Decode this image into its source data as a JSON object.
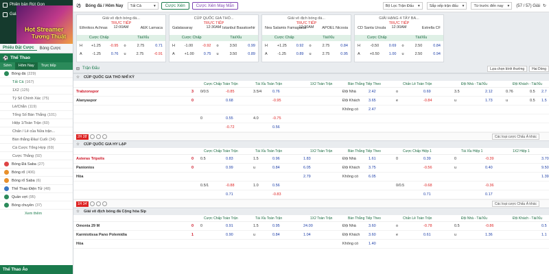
{
  "sidebar": {
    "top_buttons": [
      "Phiên bản Rút Gọn",
      "Galaxy"
    ],
    "banner_line1": "Hot Streamer",
    "banner_line2": "Tương Thuật",
    "tabs": [
      "Phiếu Đặt Cược",
      "Bóng Cược"
    ],
    "section": "Thể Thao",
    "subtabs": [
      "Sớm",
      "Hôm Nay",
      "Trực tiếp"
    ],
    "items": [
      {
        "label": "Bóng đá",
        "count": "(229)",
        "kind": "main"
      },
      {
        "label": "Tất Cả",
        "count": "(167)",
        "kind": "sub",
        "sel": true
      },
      {
        "label": "1X2",
        "count": "(125)",
        "kind": "sub"
      },
      {
        "label": "Tỷ Số Chính Xác",
        "count": "(75)",
        "kind": "sub"
      },
      {
        "label": "Lẻ/Chẵn",
        "count": "(119)",
        "kind": "sub"
      },
      {
        "label": "Tổng Số Bàn Thắng",
        "count": "(101)",
        "kind": "sub"
      },
      {
        "label": "Hiệp 1/Toàn Trận",
        "count": "(60)",
        "kind": "sub"
      },
      {
        "label": "Chấn / Lẻ của Nửa trận...",
        "count": "",
        "kind": "sub"
      },
      {
        "label": "Bàn thắng Đầu/ Cuối",
        "count": "(34)",
        "kind": "sub"
      },
      {
        "label": "Cá Cược Tổng Hợp",
        "count": "(69)",
        "kind": "sub"
      },
      {
        "label": "Cược Thắng",
        "count": "(92)",
        "kind": "sub"
      },
      {
        "label": "Bóng Đá Saba",
        "count": "(27)",
        "kind": "ball-red"
      },
      {
        "label": "Bóng rổ",
        "count": "(406)",
        "kind": "ball-or"
      },
      {
        "label": "Bóng rổ Saba",
        "count": "(6)",
        "kind": "ball-or"
      },
      {
        "label": "Thể Thao Điện Tử",
        "count": "(48)",
        "kind": "ball-bl"
      },
      {
        "label": "Quần vợt",
        "count": "(95)",
        "kind": "ball"
      },
      {
        "label": "Bóng chuyền",
        "count": "(37)",
        "kind": "ball"
      }
    ],
    "more_label": "Xem thêm",
    "footer": "Thể Thao Ảo"
  },
  "topbar": {
    "crumb": "Bóng đá / Hôm Nay",
    "select_value": "Tất Cả",
    "btn1": "Cược Xiên",
    "btn2": "Cược Xiên May Mắn",
    "filter": "Bộ Lọc Trận Đấu",
    "sort": "Sắp xếp trận đấu",
    "time": "Từ trước đến nay",
    "count": "(57 / 57) Giải"
  },
  "featured": [
    {
      "league": "Giải vô địch bóng đá...",
      "home": "Ethnikos Achnas",
      "away": "AEK Larnaca",
      "live": "TRỰC TIẾP",
      "time": "12:00AM",
      "h_hdp": "+1.25",
      "h_hdp_o": "-0.95",
      "h_ou": "2.75",
      "h_ou_o": "0.71",
      "a_hdp": "-1.25",
      "a_hdp_o": "0.76",
      "a_ou": "2.75",
      "a_ou_o": "-0.91"
    },
    {
      "league": "CÚP QUỐC GIA THỔ...",
      "home": "Galatasaray",
      "away": "Istanbul Basaksehir",
      "live": "TRỰC TIẾP",
      "time": "12:30AM",
      "h_hdp": "-1.00",
      "h_hdp_o": "-0.92",
      "h_ou": "3.50",
      "h_ou_o": "0.99",
      "a_hdp": "+1.00",
      "a_hdp_o": "0.75",
      "a_ou": "3.50",
      "a_ou_o": "0.89"
    },
    {
      "league": "Giải vô địch bóng đá...",
      "home": "Nea Salamis Famagusta",
      "away": "APOEL Nicosia",
      "live": "TRỰC TIẾP",
      "time": "12:30AM",
      "h_hdp": "+1.25",
      "h_hdp_o": "0.92",
      "h_ou": "2.75",
      "h_ou_o": "0.84",
      "a_hdp": "-1.25",
      "a_hdp_o": "0.89",
      "a_ou": "2.75",
      "a_ou_o": "0.95"
    },
    {
      "league": "GIẢI HẠNG 4 TÂY BA...",
      "home": "CD Santa Ursula",
      "away": "Estrella CF",
      "live": "TRỰC TIẾP",
      "time": "12:30AM",
      "h_hdp": "-0.50",
      "h_hdp_o": "0.69",
      "h_ou": "2.50",
      "h_ou_o": "0.84",
      "a_hdp": "+0.50",
      "a_hdp_o": "1.00",
      "a_ou": "2.50",
      "a_ou_o": "0.94"
    }
  ],
  "featured_headers": [
    "Cược Chấp",
    "Tài/Xỉu"
  ],
  "content": {
    "title": "Trận Đấu",
    "right1": "Lựa chọn bình thường",
    "right2": "Hai Dòng",
    "col_headers": [
      "Cược Chấp Toàn Trận",
      "Tài Xỉu Toàn Trận",
      "1X2 Toàn Trận",
      "Bàn Thắng Tiếp Theo",
      "Chấn Lẻ Toàn Trận",
      "Đội Nhà - Tài/Xỉu",
      "Đội Khách - Tài/Xỉu"
    ],
    "col_headers2": [
      "Cược Chấp Toàn Trận",
      "Tài Xỉu Toàn Trận",
      "1X2 Toàn Trận",
      "Bàn Thắng Tiếp Theo",
      "Cược Chấp Hiệp 1",
      "Tài Xỉu Hiệp 1",
      "1X2 Hiệp 1"
    ],
    "leagues": [
      {
        "name": "CÚP QUỐC GIA THỔ NHĨ KỲ",
        "live": "2H 28'",
        "more": "Các loại cược Chấu Á khác",
        "rows": [
          [
            "Trabzonspor",
            "3",
            "0/0.5",
            "-0.85",
            "3.5/4",
            "0.76",
            "",
            "Đội Nhà",
            "2.42",
            "o",
            "0.69",
            "3.5",
            "2.12",
            "0.76",
            "0.5",
            "2.7"
          ],
          [
            "Alanyaspor",
            "0",
            "",
            "0.68",
            "",
            "-0.95",
            "",
            "Đội Khách",
            "3.65",
            "e",
            "-0.84",
            "u",
            "1.73",
            "u",
            "0.5",
            "1.5"
          ],
          [
            "",
            "",
            "",
            "",
            "",
            "",
            "",
            "Không có",
            "2.47",
            "",
            "",
            "",
            "",
            "",
            "",
            ""
          ],
          [
            "",
            "",
            "0",
            "0.55",
            "4.0",
            "-0.75",
            "",
            "",
            "",
            "",
            "",
            "",
            "",
            "",
            "",
            ""
          ],
          [
            "",
            "",
            "",
            "-0.72",
            "",
            "0.56",
            "",
            "",
            "",
            "",
            "",
            "",
            "",
            "",
            "",
            ""
          ]
        ]
      },
      {
        "name": "CÚP QUỐC GIA HY LẠP",
        "live": "1H 34'",
        "more": "Các loại cược Chấu Á khác",
        "rows": [
          [
            "Asteras Tripolis",
            "0",
            "0.5",
            "0.83",
            "1.5",
            "0.96",
            "1.83",
            "Đội Nhà",
            "1.61",
            "0",
            "0.39",
            "0",
            "-0.39",
            "",
            "",
            "3.70"
          ],
          [
            "Panionios",
            "0",
            "",
            "0.99",
            "u",
            "0.84",
            "6.05",
            "Đội Khách",
            "3.75",
            "",
            "-0.56",
            "u",
            "0.40",
            "",
            "",
            "9.50"
          ],
          [
            "Hòa",
            "",
            "",
            "",
            "",
            "",
            "2.79",
            "Không có",
            "6.05",
            "",
            "",
            "",
            "",
            "",
            "",
            "1.39"
          ],
          [
            "",
            "",
            "0.5/1",
            "-0.88",
            "1.0",
            "0.56",
            "",
            "",
            "",
            "0/0.5",
            "-0.68",
            "",
            "-0.36",
            "",
            "",
            ""
          ],
          [
            "",
            "",
            "",
            "0.71",
            "",
            "-0.83",
            "",
            "",
            "",
            "",
            "0.71",
            "",
            "0.17",
            "",
            "",
            ""
          ]
        ]
      },
      {
        "name": "Giải vô địch bóng đá Cộng hòa Síp",
        "live": "",
        "more": "",
        "rows": [
          [
            "Omonia 29 M",
            "0",
            "0",
            "0.91",
            "1.5",
            "0.95",
            "24.00",
            "Đội Nhà",
            "3.60",
            "o",
            "-0.78",
            "0.5",
            "-0.86",
            "",
            "",
            "0.5"
          ],
          [
            "Karmiotissa Pano Polemidia",
            "1",
            "",
            "0.90",
            "u",
            "0.84",
            "1.04",
            "Đội Khách",
            "3.60",
            "e",
            "0.61",
            "u",
            "1.36",
            "",
            "",
            "1.1"
          ],
          [
            "Hòa",
            "",
            "",
            "",
            "",
            "",
            "",
            "Không có",
            "1.40",
            "",
            "",
            "",
            "",
            "",
            "",
            ""
          ]
        ]
      }
    ]
  }
}
